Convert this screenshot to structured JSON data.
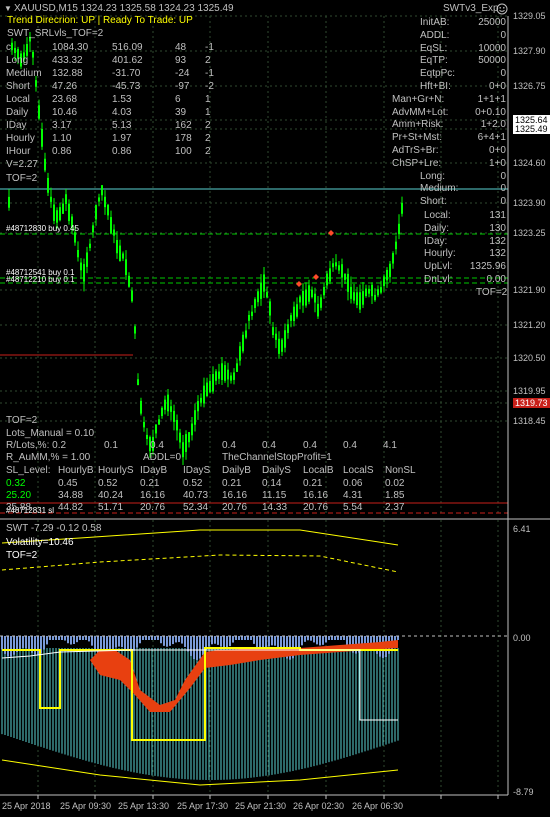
{
  "header": {
    "symbol_line": "XAUUSD,M15  1324.23 1325.58 1324.23 1325.49",
    "trend_line": "Trend Direcrion:  UP  |  Ready To Trade:  UP",
    "expert_name": "SWTv3_Exp",
    "expert_icon": "smiley-icon",
    "indicator_name": "SWT_SRLvls_TOF=2"
  },
  "colors": {
    "background": "#000000",
    "candle": "#00ff00",
    "grid": "#3a5a3a",
    "axis_text": "#c0c0c0",
    "trend_text": "#ffff00",
    "yellow_line": "#ffff00",
    "teal": "#5ad2d2",
    "blue_fill": "#7a9ad8",
    "orange_fill": "#e84010",
    "red_label": "#c8201a"
  },
  "stats_table": {
    "rows": [
      {
        "label": "c",
        "v1": "1084.30",
        "v2": "516.09",
        "v3": "48",
        "v4": "-1"
      },
      {
        "label": "Long",
        "v1": "433.32",
        "v2": "401.62",
        "v3": "93",
        "v4": "2"
      },
      {
        "label": "Medium",
        "v1": "132.88",
        "v2": "-31.70",
        "v3": "-24",
        "v4": "-1"
      },
      {
        "label": "Short",
        "v1": "47.26",
        "v2": "-45.73",
        "v3": "-97",
        "v4": "-2"
      },
      {
        "label": "Local",
        "v1": "23.68",
        "v2": "1.53",
        "v3": "6",
        "v4": "1"
      },
      {
        "label": "Daily",
        "v1": "10.46",
        "v2": "4.03",
        "v3": "39",
        "v4": "1"
      },
      {
        "label": "IDay",
        "v1": "3.17",
        "v2": "5.13",
        "v3": "162",
        "v4": "2"
      },
      {
        "label": "Hourly",
        "v1": "1.10",
        "v2": "1.97",
        "v3": "178",
        "v4": "2"
      },
      {
        "label": "IHour",
        "v1": "0.86",
        "v2": "0.86",
        "v3": "100",
        "v4": "2"
      }
    ],
    "v_line": "V=2.27",
    "tof_line": "TOF=2"
  },
  "right_panel": [
    {
      "label": "InitAB:",
      "value": "25000"
    },
    {
      "label": "ADDL:",
      "value": "0"
    },
    {
      "label": "EqSL:",
      "value": "10000"
    },
    {
      "label": "EqTP:",
      "value": "50000"
    },
    {
      "label": "EqtpPc:",
      "value": "0"
    },
    {
      "label": "Hft+BI:",
      "value": "0+0"
    },
    {
      "label": "Man+Gr+N:",
      "value": "1+1+1"
    },
    {
      "label": "AdvMM+Lot:",
      "value": "0+0.10"
    },
    {
      "label": "Amm+Risk:",
      "value": "1+2.0"
    },
    {
      "label": "Pr+St+Mst:",
      "value": "6+4+1"
    },
    {
      "label": "AdTrS+Br:",
      "value": "0+0"
    },
    {
      "label": "ChSP+Lre:",
      "value": "1+0"
    },
    {
      "label": "Long:",
      "value": "0"
    },
    {
      "label": "Medium:",
      "value": "0"
    },
    {
      "label": "Short:",
      "value": "0"
    }
  ],
  "levels_panel": [
    {
      "label": "Local:",
      "value": "131"
    },
    {
      "label": "Daily:",
      "value": "130"
    },
    {
      "label": "IDay:",
      "value": "132"
    },
    {
      "label": "Hourly:",
      "value": "132"
    },
    {
      "label": "UpLvl:",
      "value": "1325.96"
    },
    {
      "label": "DnLvl:",
      "value": "0.00"
    }
  ],
  "levels_tof": "TOF=2",
  "trade_labels": [
    {
      "text": "#48712830 buy 0.45"
    },
    {
      "text": "#48712541 buy 0.1"
    },
    {
      "text": "#48712210 buy 0.1"
    },
    {
      "text": "#48712831 sl"
    }
  ],
  "bottom_info": {
    "tof": "TOF=2",
    "lots_manual": "Lots_Manual = 0.10",
    "r_lots_label": "R/Lots,%: 0.2",
    "r_lots_values": [
      "0.1",
      "0.4",
      "0.4",
      "0.4",
      "0.4",
      "0.4",
      "4.1"
    ],
    "r_aumm": "R_AuMM,% = 1.00",
    "addl": "ADDL=0",
    "channel_stop": "TheChannelStopProfit=1"
  },
  "sl_table": {
    "headers": [
      "SL_Level:",
      "HourlyB",
      "HourlyS",
      "IDayB",
      "IDayS",
      "DailyB",
      "DailyS",
      "LocalB",
      "LocalS",
      "NonSL"
    ],
    "rows": [
      {
        "color": "#00ff00",
        "cells": [
          "0.32",
          "0.45",
          "0.52",
          "0.21",
          "0.52",
          "0.21",
          "0.14",
          "0.21",
          "0.06",
          "0.02"
        ]
      },
      {
        "color": "#00ff00",
        "cells": [
          "25.20",
          "34.88",
          "40.24",
          "16.16",
          "40.73",
          "16.16",
          "11.15",
          "16.16",
          "4.31",
          "1.85"
        ]
      },
      {
        "color": "#c0c0c0",
        "cells": [
          "35.88",
          "44.82",
          "51.71",
          "20.76",
          "52.34",
          "20.76",
          "14.33",
          "20.76",
          "5.54",
          "2.37"
        ]
      }
    ]
  },
  "price_labels": [
    "1329.05",
    "1327.90",
    "1326.75",
    "1325.64",
    "1325.49",
    "1324.60",
    "1323.90",
    "1323.25",
    "1321.90",
    "1321.20",
    "1320.50",
    "1319.95",
    "1319.73",
    "1318.45"
  ],
  "price_highlights": {
    "1325.64": {
      "bg": "#ffffff",
      "fg": "#000000"
    },
    "1325.49": {
      "bg": "#ffffff",
      "fg": "#000000"
    },
    "1319.73": {
      "bg": "#c8201a",
      "fg": "#ffffff"
    }
  },
  "sub_indicator": {
    "title": "SWT -7.29 -0.12 0.58",
    "volatility": "Volatility=10.46",
    "tof": "TOF=2",
    "scale_top": "6.41",
    "scale_zero": "0.00",
    "scale_bottom": "-8.79"
  },
  "time_axis": [
    "25 Apr 2018",
    "25 Apr 09:30",
    "25 Apr 13:30",
    "25 Apr 17:30",
    "25 Apr 21:30",
    "26 Apr 02:30",
    "26 Apr 06:30"
  ],
  "chart_data": {
    "type": "candlestick",
    "symbol": "XAUUSD",
    "timeframe": "M15",
    "last_quote": {
      "open": 1324.23,
      "high": 1325.58,
      "low": 1324.23,
      "close": 1325.49
    },
    "y_ticks": [
      1329.05,
      1327.9,
      1326.75,
      1325.64,
      1325.49,
      1324.6,
      1323.9,
      1323.25,
      1321.9,
      1321.2,
      1320.5,
      1319.95,
      1319.73,
      1318.45
    ],
    "x_ticks": [
      "25 Apr 2018",
      "25 Apr 09:30",
      "25 Apr 13:30",
      "25 Apr 17:30",
      "25 Apr 21:30",
      "26 Apr 02:30",
      "26 Apr 06:30"
    ]
  }
}
